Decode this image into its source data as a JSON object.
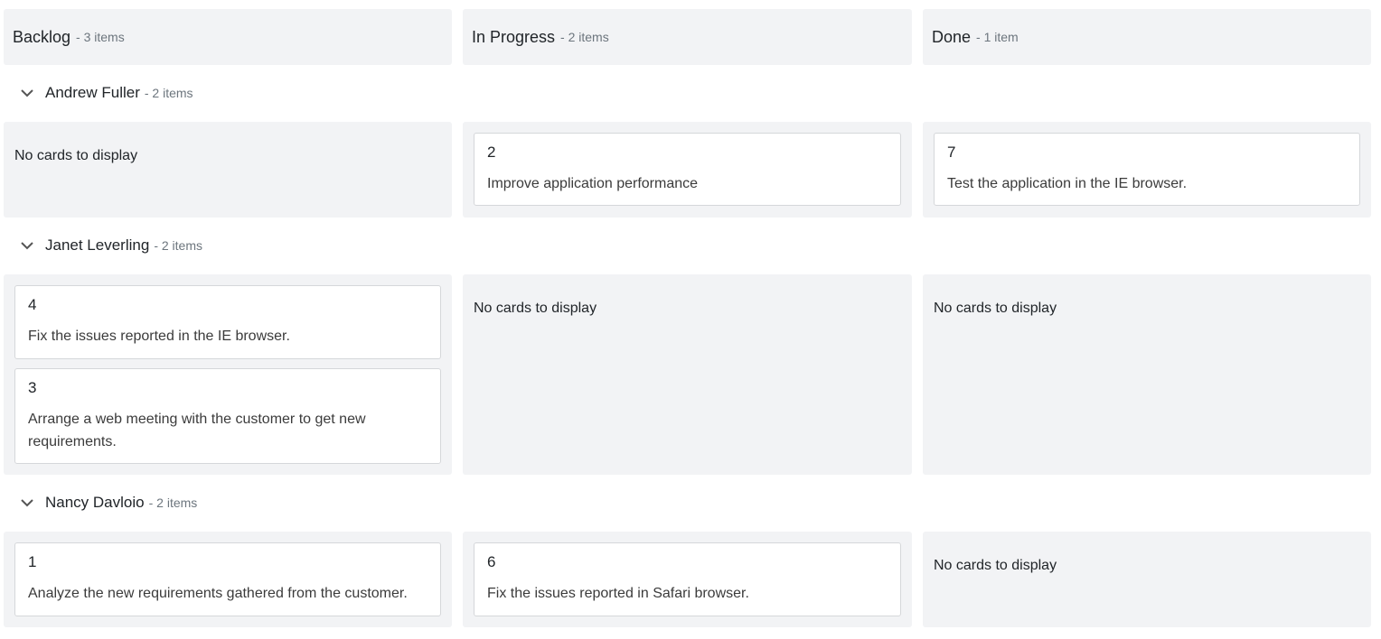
{
  "columns": [
    {
      "title": "Backlog",
      "count": "- 3 items"
    },
    {
      "title": "In Progress",
      "count": "- 2 items"
    },
    {
      "title": "Done",
      "count": "- 1 item"
    }
  ],
  "swimlanes": [
    {
      "name": "Andrew Fuller",
      "count": "- 2 items",
      "cells": [
        {
          "empty_text": "No cards to display"
        },
        {
          "cards": [
            {
              "id": "2",
              "summary": "Improve application performance"
            }
          ]
        },
        {
          "cards": [
            {
              "id": "7",
              "summary": "Test the application in the IE browser."
            }
          ]
        }
      ]
    },
    {
      "name": "Janet Leverling",
      "count": "- 2 items",
      "cells": [
        {
          "cards": [
            {
              "id": "4",
              "summary": "Fix the issues reported in the IE browser."
            },
            {
              "id": "3",
              "summary": "Arrange a web meeting with the customer to get new requirements."
            }
          ]
        },
        {
          "empty_text": "No cards to display"
        },
        {
          "empty_text": "No cards to display"
        }
      ]
    },
    {
      "name": "Nancy Davloio",
      "count": "- 2 items",
      "cells": [
        {
          "cards": [
            {
              "id": "1",
              "summary": "Analyze the new requirements gathered from the customer."
            }
          ]
        },
        {
          "cards": [
            {
              "id": "6",
              "summary": "Fix the issues reported in Safari browser."
            }
          ]
        },
        {
          "empty_text": "No cards to display"
        }
      ]
    }
  ],
  "icons": {
    "swimlane_toggle": "chevron-down-icon"
  },
  "colors": {
    "cell_background": "#f2f3f5",
    "card_background": "#ffffff",
    "card_border": "#d5d7da",
    "muted_text": "#6c757d"
  }
}
